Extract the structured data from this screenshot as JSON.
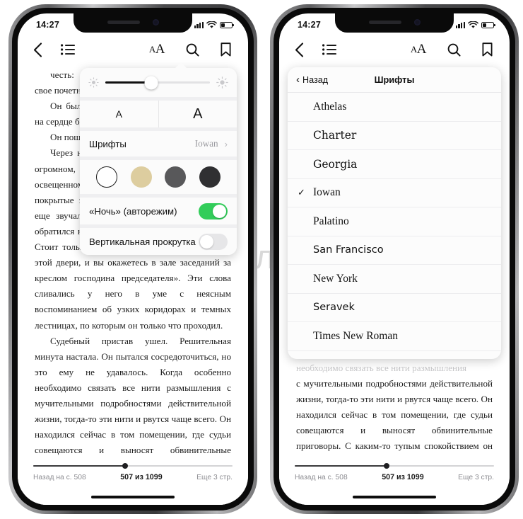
{
  "watermark": "Яблык",
  "status": {
    "time": "14:27",
    "signal_icon": "signal-bars-icon",
    "wifi_icon": "wifi-icon",
    "battery_icon": "battery-low-icon",
    "battery_level_pct": 38
  },
  "navbar": {
    "back_icon": "chevron-left-icon",
    "contents_icon": "list-contents-icon",
    "appearance_icon": "aa-text-size-icon",
    "appearance_small_label": "A",
    "appearance_large_label": "A",
    "search_icon": "search-icon",
    "bookmark_icon": "bookmark-icon"
  },
  "reader": {
    "back_to_page": "Назад на с. 508",
    "page_of": "507 из 1099",
    "pages_left": "Еще 3 стр.",
    "progress_pct": 46
  },
  "book": {
    "left_page_paragraphs": [
      "честь: «Позвольте, сударь, указать вам на свое почетное место».",
      "Он был бледен, руки его немного дрожали, на сердце было тяжело и горько.",
      "Он пошел за судебным приставом.",
      "Через несколько шагов он очутился один в огромном, мрачном, полупустом зале, освещенном тусклым светом, падавшим на покрытые зеленым сукном столы. В ушах его еще звучали слова пристава, с которыми тот обратился к нему: «Сударь! Это почетное место. Стоит только вам повернуть медную ручку вот этой двери, и вы окажетесь в зале заседаний за креслом господина председателя». Эти слова сливались у него в уме с неясным воспоминанием об узких коридорах и темных лестницах, по которым он только что проходил.",
      "Судебный пристав ушел. Решительная минута настала. Он пытался сосредоточиться, но это ему не удавалось. Когда особенно необходимо связать все нити размышления с мучительными подробностями действительной жизни, тогда-то эти нити и рвутся чаще всего. Он находился сейчас в том помещении, где судьи совещаются и выносят обвинительные приговоры. С каким-то тупым спокойствием он рассматривал эту мирную и вместе с тем грозную комнату, где было разбито столько жизней, где через"
    ],
    "right_page_faded_line": "необходимо связать все нити размышления",
    "right_page_paragraph": "с мучительными подробностями действительной жизни, тогда-то эти нити и рвутся чаще всего. Он находился сейчас в том помещении, где судьи совещаются и выносят обвинительные приговоры. С каким-то тупым спокойствием он рассматривал эту мирную и вместе с тем грозную комнату, где было разбито столько жизней, где через"
  },
  "appearance_popup": {
    "brightness": {
      "low_icon": "brightness-low-icon",
      "high_icon": "brightness-high-icon",
      "value_pct": 44
    },
    "font_size": {
      "decrease_label": "A",
      "increase_label": "A"
    },
    "fonts_row": {
      "label": "Шрифты",
      "value": "Iowan",
      "chevron_icon": "chevron-right-icon"
    },
    "themes": [
      {
        "name": "white",
        "color": "#ffffff",
        "selected": true
      },
      {
        "name": "sepia",
        "color": "#ddcd9f",
        "selected": false
      },
      {
        "name": "gray",
        "color": "#58585a",
        "selected": false
      },
      {
        "name": "black",
        "color": "#303032",
        "selected": false
      }
    ],
    "night_mode": {
      "label": "«Ночь» (авторежим)",
      "on": true
    },
    "vertical_scroll": {
      "label": "Вертикальная прокрутка",
      "on": false
    },
    "toggle_on_color": "#32cd5a",
    "toggle_off_color": "#e6e6e8"
  },
  "font_panel": {
    "back_label": "Назад",
    "back_icon": "chevron-left-icon",
    "title": "Шрифты",
    "check_icon": "checkmark-icon",
    "items": [
      {
        "name": "Athelas",
        "selected": false
      },
      {
        "name": "Charter",
        "selected": false
      },
      {
        "name": "Georgia",
        "selected": false
      },
      {
        "name": "Iowan",
        "selected": true
      },
      {
        "name": "Palatino",
        "selected": false
      },
      {
        "name": "San Francisco",
        "selected": false
      },
      {
        "name": "New York",
        "selected": false
      },
      {
        "name": "Seravek",
        "selected": false
      },
      {
        "name": "Times New Roman",
        "selected": false
      }
    ]
  }
}
